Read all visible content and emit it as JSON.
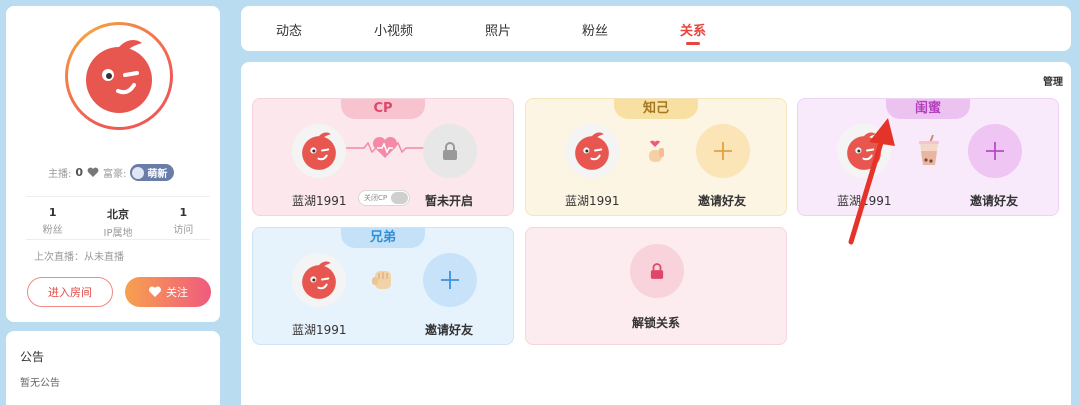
{
  "profile": {
    "anchor_label": "主播:",
    "anchor_level": "0",
    "rich_label": "富豪:",
    "rich_badge": "萌新",
    "stats": [
      {
        "value": "1",
        "label": "粉丝"
      },
      {
        "value": "北京",
        "label": "IP属地"
      },
      {
        "value": "1",
        "label": "访问"
      }
    ],
    "last_live": "上次直播：从未直播",
    "enter_room": "进入房间",
    "follow": "关注"
  },
  "notice": {
    "title": "公告",
    "body": "暂无公告"
  },
  "tabs": [
    {
      "label": "动态"
    },
    {
      "label": "小视频"
    },
    {
      "label": "照片"
    },
    {
      "label": "粉丝"
    },
    {
      "label": "关系"
    }
  ],
  "main": {
    "manage": "管理",
    "cp": {
      "tag": "CP",
      "user_name": "蓝湖1991",
      "toggle_label": "关闭CP",
      "status": "暂未开启"
    },
    "zhiji": {
      "tag": "知己",
      "user_name": "蓝湖1991",
      "invite": "邀请好友"
    },
    "guimi": {
      "tag": "闺蜜",
      "user_name": "蓝湖1991",
      "invite": "邀请好友"
    },
    "xiongdi": {
      "tag": "兄弟",
      "user_name": "蓝湖1991",
      "invite": "邀请好友"
    },
    "unlock": {
      "label": "解锁关系"
    }
  },
  "colors": {
    "accent": "#e8453c",
    "brand_red": "#f05a55",
    "page_bg": "#b9dcf0"
  }
}
